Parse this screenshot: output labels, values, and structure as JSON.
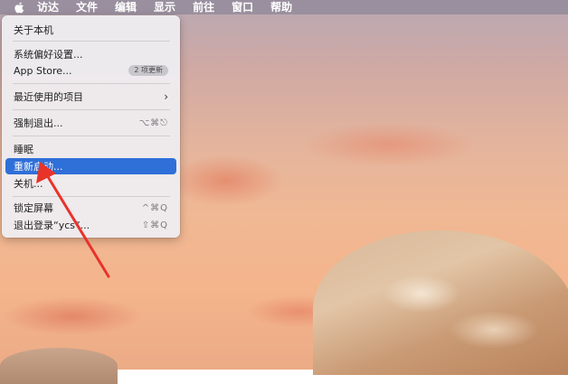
{
  "menubar": {
    "items": [
      "访达",
      "文件",
      "编辑",
      "显示",
      "前往",
      "窗口",
      "帮助"
    ]
  },
  "apple_menu": {
    "about": "关于本机",
    "system_prefs": "系统偏好设置...",
    "app_store": "App Store...",
    "app_store_badge": "2 项更新",
    "recent_items": "最近使用的项目",
    "force_quit": "强制退出...",
    "force_quit_shortcut": "⌥⌘⎋",
    "sleep": "睡眠",
    "restart": "重新启动...",
    "shutdown": "关机...",
    "lock_screen": "锁定屏幕",
    "lock_screen_shortcut": "^⌘Q",
    "logout": "退出登录“ycs”...",
    "logout_shortcut": "⇧⌘Q"
  },
  "colors": {
    "highlight": "#2f6fd8",
    "annotation_arrow": "#e8332a"
  },
  "icons": {
    "apple": "apple-logo-icon",
    "submenu": "chevron-right-icon",
    "annotation": "red-arrow-icon"
  }
}
